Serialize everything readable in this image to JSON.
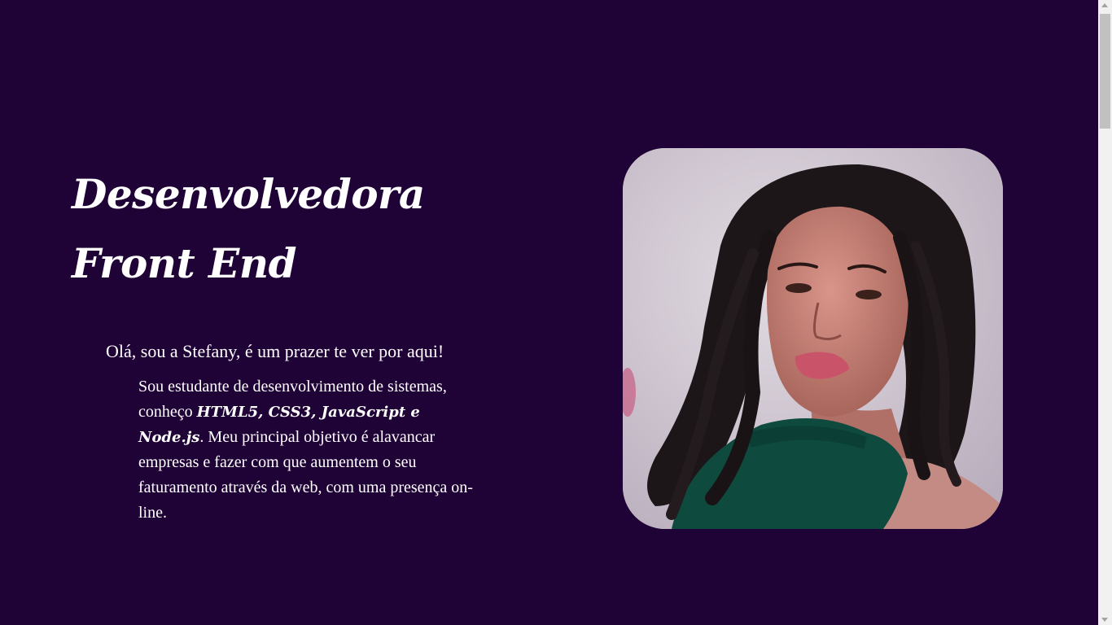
{
  "hero": {
    "title_line1": "Desenvolvedora",
    "title_line2": "Front End"
  },
  "intro": {
    "greeting": "Olá, sou a Stefany, é um prazer te ver por aqui!",
    "bio_part1": "Sou estudante de desenvolvimento de sistemas, conheço ",
    "bio_skills": "HTML5, CSS3, JavaScript e Node.js",
    "bio_part2": ". Meu principal objetivo é alavancar empresas e fazer com que aumentem o seu faturamento através da web, com uma presença on-line."
  },
  "profile_photo": {
    "subject": "portrait-photo"
  },
  "colors": {
    "background": "#200336",
    "text": "#ffffff"
  }
}
